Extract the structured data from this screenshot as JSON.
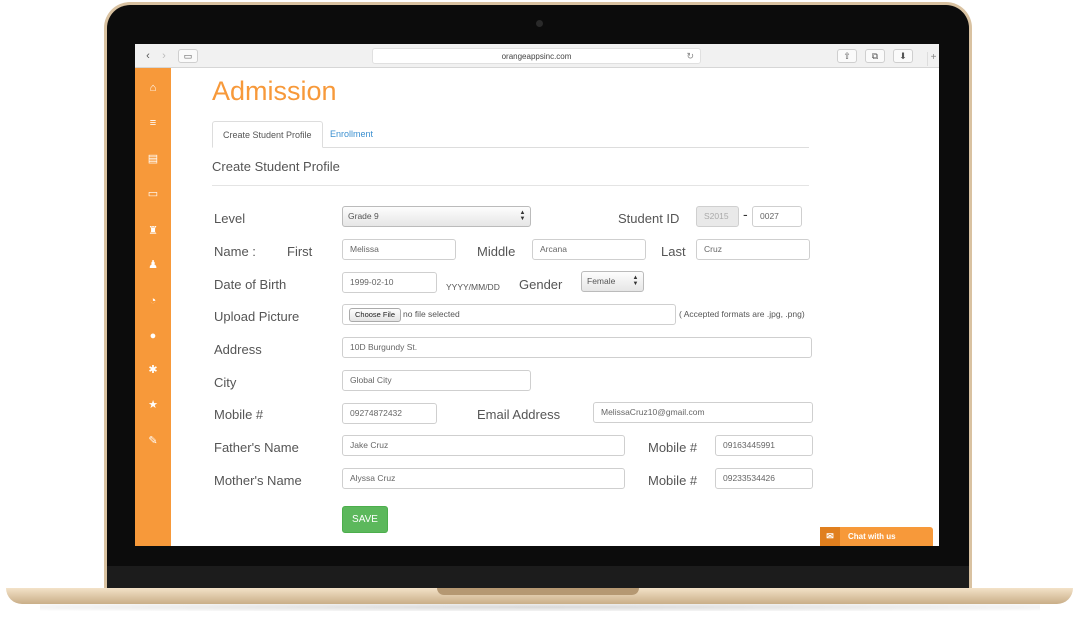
{
  "browser": {
    "url": "orangeappsinc.com",
    "back_icon": "chevron-left-icon",
    "forward_icon": "chevron-right-icon",
    "back_glyph": "‹",
    "forward_glyph": "›",
    "sidebar_glyph": "▭",
    "reload_glyph": "↻",
    "share_glyph": "⇧",
    "tabs_glyph": "⧉",
    "download_glyph": "⬇",
    "plus_glyph": "+"
  },
  "sidebar": {
    "accent_color": "#f7993a",
    "items": [
      {
        "icon": "home-icon",
        "glyph": "⌂"
      },
      {
        "icon": "layers-icon",
        "glyph": "≡"
      },
      {
        "icon": "document-icon",
        "glyph": "▤"
      },
      {
        "icon": "card-icon",
        "glyph": "▭"
      },
      {
        "icon": "graduate-icon",
        "glyph": "♜"
      },
      {
        "icon": "users-icon",
        "glyph": "♟"
      },
      {
        "icon": "chart-icon",
        "glyph": "◔"
      },
      {
        "icon": "idea-icon",
        "glyph": "●"
      },
      {
        "icon": "settings-icon",
        "glyph": "✱"
      },
      {
        "icon": "star-icon",
        "glyph": "★"
      },
      {
        "icon": "pin-icon",
        "glyph": "✎"
      }
    ]
  },
  "page": {
    "title": "Admission",
    "tabs": [
      {
        "label": "Create Student Profile",
        "active": true
      },
      {
        "label": "Enrollment",
        "active": false
      }
    ],
    "section_title": "Create Student Profile"
  },
  "form": {
    "level_label": "Level",
    "level_value": "Grade 9",
    "student_id_label": "Student ID",
    "student_id_prefix": "S2015",
    "student_id_dash": "-",
    "student_id_number": "0027",
    "name_label": "Name :",
    "first_label": "First",
    "first_value": "Melissa",
    "middle_label": "Middle",
    "middle_value": "Arcana",
    "last_label": "Last",
    "last_value": "Cruz",
    "dob_label": "Date of Birth",
    "dob_value": "1999-02-10",
    "dob_format": "YYYY/MM/DD",
    "gender_label": "Gender",
    "gender_value": "Female",
    "upload_label": "Upload Picture",
    "choose_file": "Choose File",
    "no_file": "no file selected",
    "accepted_formats": "( Accepted formats are .jpg, .png)",
    "address_label": "Address",
    "address_value": "10D Burgundy St.",
    "city_label": "City",
    "city_value": "Global City",
    "mobile_label": "Mobile #",
    "mobile_value": "09274872432",
    "email_label": "Email Address",
    "email_value": "MelissaCruz10@gmail.com",
    "father_label": "Father's Name",
    "father_value": "Jake Cruz",
    "father_mobile_label": "Mobile #",
    "father_mobile_value": "09163445991",
    "mother_label": "Mother's Name",
    "mother_value": "Alyssa Cruz",
    "mother_mobile_label": "Mobile #",
    "mother_mobile_value": "09233534426",
    "save_label": "SAVE",
    "save_color": "#5cb85c"
  },
  "chat": {
    "label": "Chat with us",
    "icon": "mail-icon",
    "glyph": "✉"
  }
}
